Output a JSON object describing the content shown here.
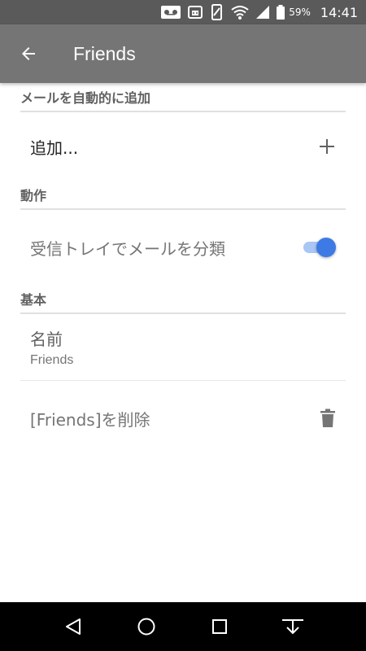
{
  "status_bar": {
    "battery_percent": "59%",
    "time": "14:41",
    "icons": [
      "voicemail-icon",
      "android-icon",
      "rotate-icon",
      "wifi-icon",
      "signal-icon",
      "battery-icon"
    ]
  },
  "app_bar": {
    "title": "Friends",
    "back_icon": "arrow-back-icon"
  },
  "sections": {
    "auto_add": {
      "header": "メールを自動的に追加",
      "add_label": "追加...",
      "add_icon": "plus-icon"
    },
    "action": {
      "header": "動作",
      "sort_inbox_label": "受信トレイでメールを分類",
      "sort_inbox_enabled": true
    },
    "basic": {
      "header": "基本",
      "name_label": "名前",
      "name_value": "Friends",
      "delete_label": "[Friends]を削除",
      "delete_icon": "trash-icon"
    }
  },
  "nav_bar": {
    "icons": [
      "back-triangle-icon",
      "home-circle-icon",
      "recents-square-icon",
      "download-icon"
    ]
  },
  "colors": {
    "status_bar": "#5a5a5a",
    "app_bar": "#757575",
    "toggle_accent": "#3d7ae5",
    "nav_bar": "#000000"
  }
}
